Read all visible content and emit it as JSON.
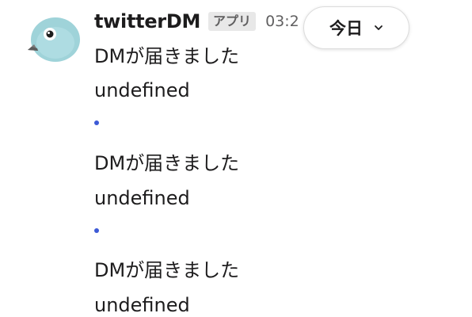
{
  "message": {
    "sender": "twitterDM",
    "app_badge": "アプリ",
    "time": "03:2"
  },
  "date_divider": {
    "label": "今日"
  },
  "lines": [
    {
      "title": "DMが届きました",
      "body": "undefined"
    },
    {
      "title": "DMが届きました",
      "body": "undefined"
    },
    {
      "title": "DMが届きました",
      "body": "undefined"
    }
  ],
  "colors": {
    "bullet": "#3d5ad6",
    "badge_bg": "#e8e8e8",
    "avatar_body": "#9fd3d9"
  },
  "icons": {
    "avatar": "bird-avatar-icon",
    "chevron": "chevron-down-icon",
    "bullet": "bullet-dot-icon"
  }
}
